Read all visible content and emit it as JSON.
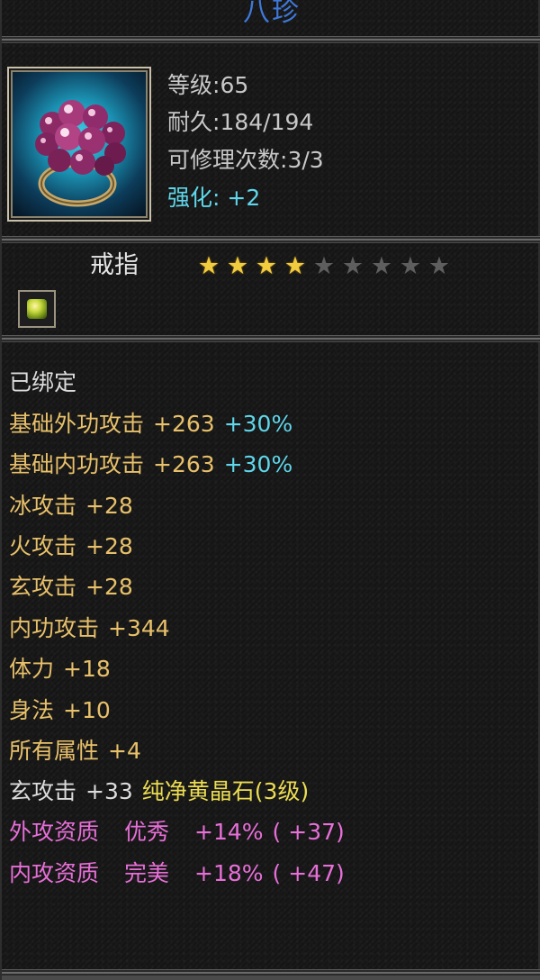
{
  "title": "八珍",
  "item_icon": "purple-pearl-ring-icon",
  "stats": {
    "level": {
      "label": "等级:",
      "value": "65"
    },
    "durability": {
      "label": "耐久:",
      "value": "184/194"
    },
    "repairs": {
      "label": "可修理次数:",
      "value": "3/3"
    },
    "enhance": {
      "label": "强化: ",
      "value": "+2"
    }
  },
  "item_type": "戒指",
  "star_rating": {
    "filled": 4,
    "total": 9
  },
  "gem_socket_icon": "yellow-gem-icon",
  "attributes": {
    "bound": "已绑定",
    "base_ext_attack": {
      "label": "基础外功攻击",
      "value": "+263",
      "bonus": "+30%"
    },
    "base_int_attack": {
      "label": "基础内功攻击",
      "value": "+263",
      "bonus": "+30%"
    },
    "ice_attack": {
      "label": "冰攻击",
      "value": "+28"
    },
    "fire_attack": {
      "label": "火攻击",
      "value": "+28"
    },
    "xuan_attack": {
      "label": "玄攻击",
      "value": "+28"
    },
    "int_attack": {
      "label": "内功攻击",
      "value": "+344"
    },
    "stamina": {
      "label": "体力",
      "value": "+18"
    },
    "agility": {
      "label": "身法",
      "value": "+10"
    },
    "all_attributes": {
      "label": "所有属性",
      "value": "+4"
    },
    "gem_bonus": {
      "label": "玄攻击",
      "value": "+33",
      "gem": "纯净黄晶石(3级)"
    },
    "ext_quality": {
      "label": "外攻资质",
      "grade": "优秀",
      "percent": "+14%",
      "extra": "( +37)"
    },
    "int_quality": {
      "label": "内攻资质",
      "grade": "完美",
      "percent": "+18%",
      "extra": "( +47)"
    }
  },
  "colors": {
    "title": "#3f78d8",
    "stat": "#c8c8c8",
    "cyan": "#5fd6ea",
    "gold": "#e8c06a",
    "yellow": "#ecdc52",
    "pink": "#e76fd8",
    "star_on": "#f1cc3e",
    "star_off": "#5e5e5e"
  }
}
